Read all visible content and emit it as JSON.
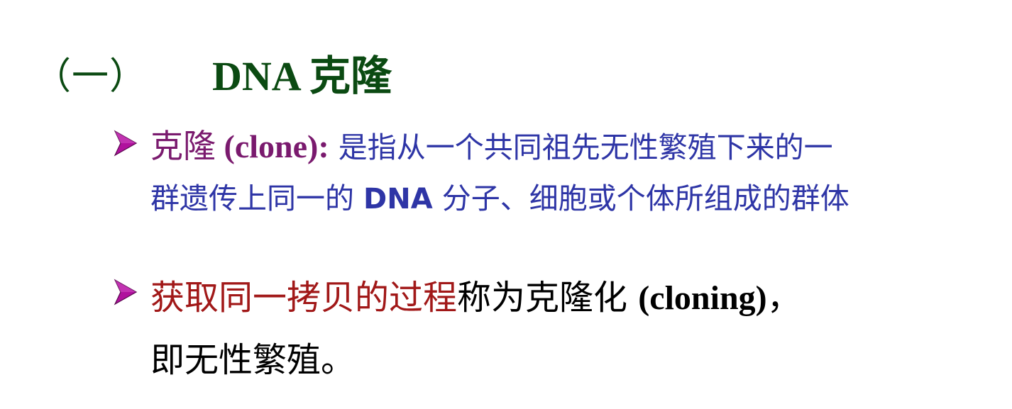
{
  "heading": {
    "number": "（一）",
    "title": "DNA 克隆"
  },
  "bullets": [
    {
      "term": "克隆",
      "term_en": " (clone):",
      "definition_line1": " 是指从一个共同祖先无性繁殖下来的一",
      "definition_line2_start": "群遗传上同一的 ",
      "definition_line2_bold": "DNA",
      "definition_line2_end": " 分子、细胞或个体所组成的群体"
    },
    {
      "highlight": "获取同一拷贝的过程",
      "text": "称为克隆化 ",
      "text_en": "(cloning)",
      "text_tail": "，",
      "line2": "即无性繁殖。"
    }
  ],
  "colors": {
    "heading": "#0b4a12",
    "term": "#7a1a6e",
    "definition": "#2e35a6",
    "highlight": "#a11818",
    "bullet_arrow": "#b0119d"
  },
  "icons": {
    "bullet": "arrow-bullet-icon"
  }
}
